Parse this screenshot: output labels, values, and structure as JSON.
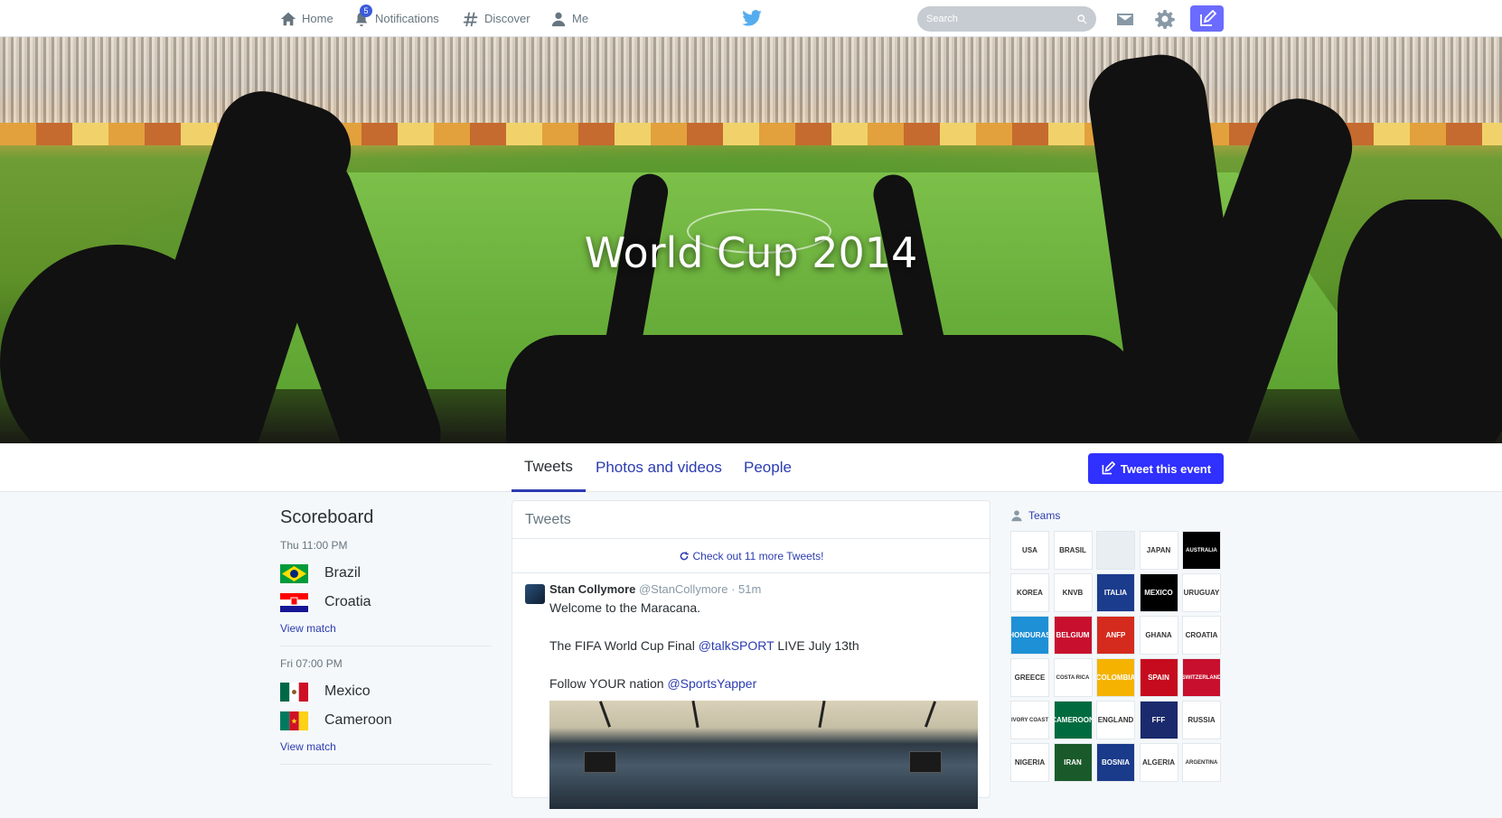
{
  "nav": {
    "home": "Home",
    "notifications": "Notifications",
    "notifications_count": "5",
    "discover": "Discover",
    "me": "Me",
    "search_placeholder": "Search"
  },
  "hero": {
    "title": "World Cup 2014"
  },
  "tabs": [
    {
      "label": "Tweets"
    },
    {
      "label": "Photos and videos"
    },
    {
      "label": "People"
    }
  ],
  "tweet_event_label": "Tweet this event",
  "scoreboard": {
    "title": "Scoreboard",
    "matches": [
      {
        "time": "Thu 11:00 PM",
        "home": "Brazil",
        "away": "Croatia",
        "link": "View match"
      },
      {
        "time": "Fri 07:00 PM",
        "home": "Mexico",
        "away": "Cameroon",
        "link": "View match"
      }
    ]
  },
  "timeline": {
    "header": "Tweets",
    "more": "Check out 11 more Tweets!",
    "tweet": {
      "name": "Stan Collymore",
      "handle": "@StanCollymore",
      "time": "51m",
      "line1": "Welcome to the Maracana.",
      "line2_pre": "The FIFA World Cup Final ",
      "line2_mention": "@talkSPORT",
      "line2_post": " LIVE July 13th",
      "line3_pre": "Follow YOUR nation ",
      "line3_mention": "@SportsYapper"
    }
  },
  "teams": {
    "title": "Teams",
    "crests": [
      "USA",
      "BRASIL",
      "",
      "JAPAN",
      "AUSTRALIA",
      "KOREA",
      "KNVB",
      "ITALIA",
      "MEXICO",
      "URUGUAY",
      "HONDURAS",
      "BELGIUM",
      "ANFP",
      "GHANA",
      "CROATIA",
      "GREECE",
      "COSTA RICA",
      "COLOMBIA",
      "SPAIN",
      "SWITZERLAND",
      "IVORY COAST",
      "CAMEROON",
      "ENGLAND",
      "FFF",
      "RUSSIA",
      "NIGERIA",
      "IRAN",
      "BOSNIA",
      "ALGERIA",
      "ARGENTINA"
    ]
  },
  "colors": {
    "accent": "#2b3cb0",
    "button": "#3030ff",
    "compose": "#6b6bff"
  }
}
